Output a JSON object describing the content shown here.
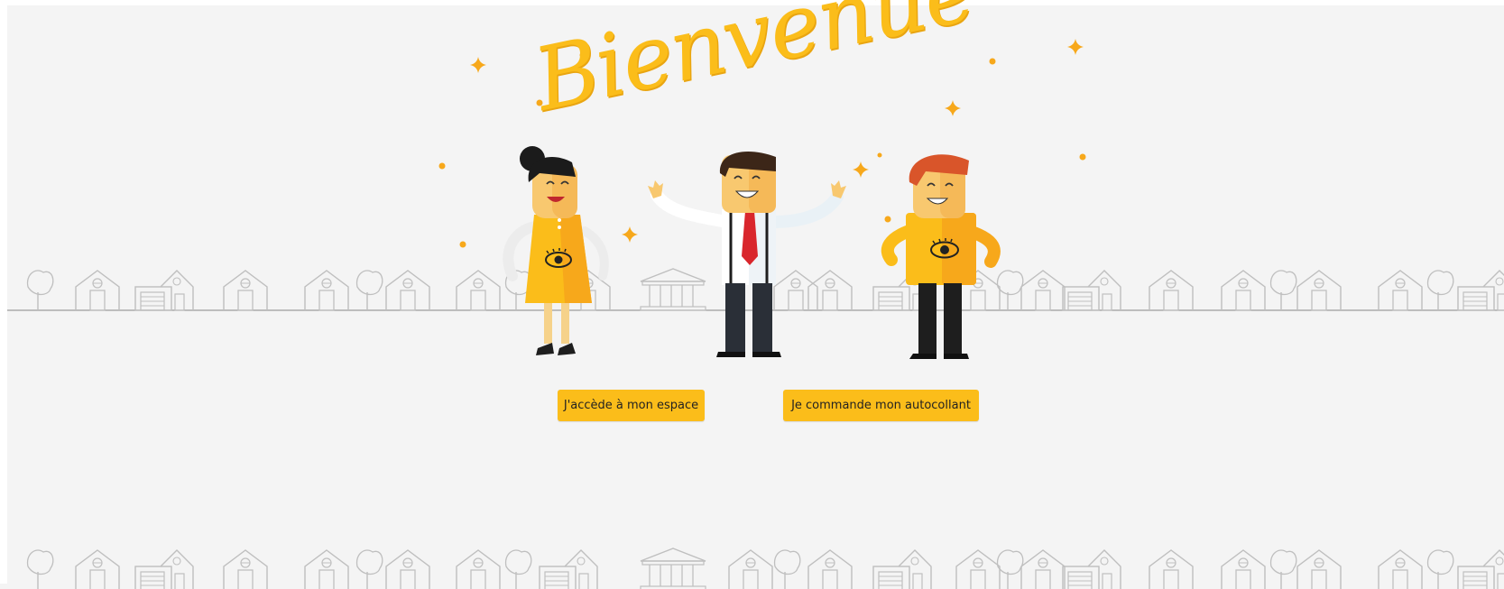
{
  "welcome": {
    "title": "Bienvenue"
  },
  "actions": {
    "access_label": "J'accède à mon espace",
    "order_label": "Je commande mon autocollant"
  },
  "colors": {
    "accent": "#fbbd1a",
    "background": "#f4f4f4",
    "shirt": "#fbbd1a",
    "tie": "#d9262c"
  },
  "icons": [
    "house-icon",
    "tree-icon",
    "building-icon",
    "eye-icon",
    "sparkle-icon"
  ]
}
